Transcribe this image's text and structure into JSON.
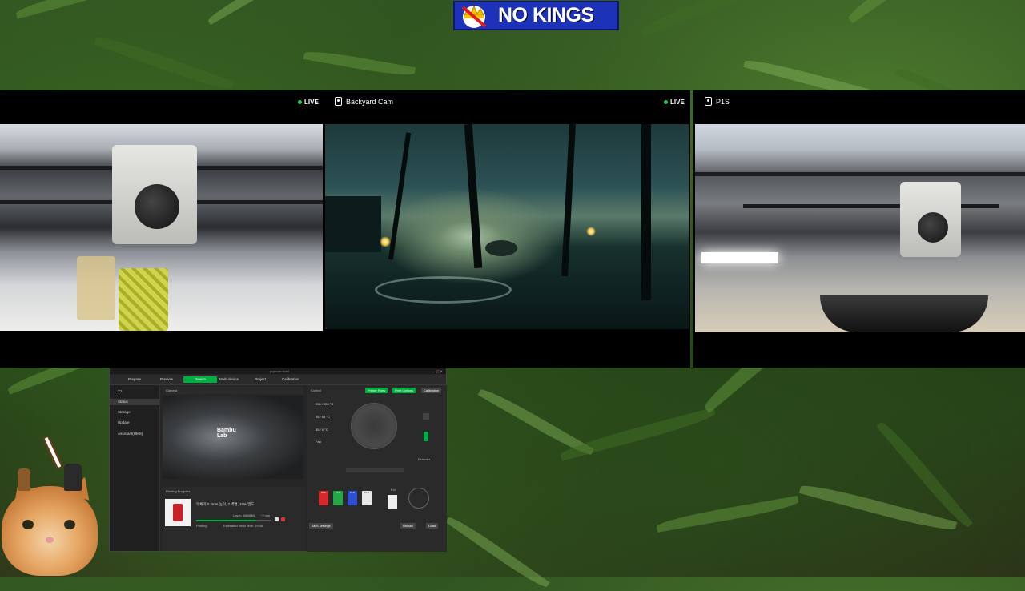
{
  "banner": {
    "text": "NO KINGS",
    "bg_color": "#1c32b8",
    "icon": "crown-icon"
  },
  "cameras": [
    {
      "title": "",
      "live": "LIVE",
      "icon": "camera-icon"
    },
    {
      "title": "Backyard Cam",
      "live": "LIVE",
      "icon": "camera-icon"
    },
    {
      "title": "P1S",
      "live": "",
      "icon": "camera-icon"
    }
  ],
  "app": {
    "window_title": "popcorn bowl",
    "tabs": [
      "Prepare",
      "Preview",
      "Device",
      "Multi-device",
      "Project",
      "Calibration"
    ],
    "active_tab": "Device",
    "printer_name": "X1",
    "sidebar": [
      "Status",
      "Storage",
      "Update",
      "Assistant(HMS)"
    ],
    "camera_label": "Camera",
    "camera_logo_line1": "Bambu",
    "camera_logo_line2": "Lab",
    "control_label": "Control",
    "control_buttons": [
      "Printer Parts",
      "Print Options",
      "Calibration"
    ],
    "temps": [
      "220 / 220 °C",
      "55 / 55 °C",
      "35 / 0 °C"
    ],
    "fan_label": "Fan",
    "extruder_label": "Extruder",
    "progress_label": "Printing Progress",
    "job_line": "부채의 0.2mm 높이, 2 벽면, 15% 밀도",
    "progress_percent": 80,
    "job_status": "Printing",
    "layer_text": "Layer: 588/688",
    "time_text": "~3 min",
    "estimated_text": "Estimated finish time: 19:06",
    "ams": {
      "ext_label": "Ext",
      "spools": [
        {
          "name": "PLA",
          "color": "#d62a2a"
        },
        {
          "name": "PLA",
          "color": "#22a845"
        },
        {
          "name": "PLA",
          "color": "#2b4fd0"
        },
        {
          "name": "PLA",
          "color": "#e8e8e8"
        }
      ],
      "ams_settings": "AMS settings",
      "unload": "Unload",
      "load": "Load"
    },
    "accent_color": "#00ae42"
  }
}
